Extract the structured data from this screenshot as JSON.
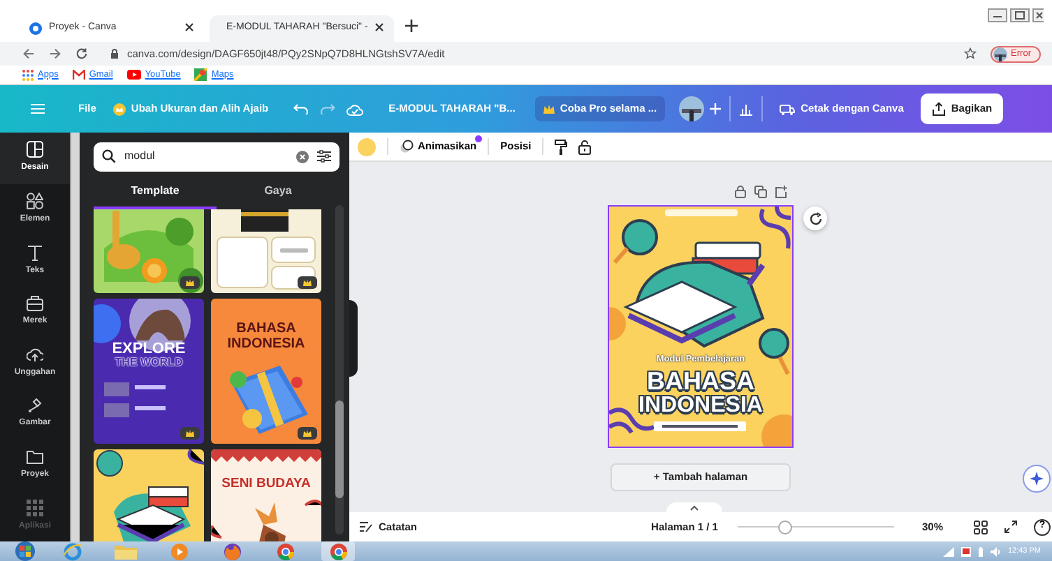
{
  "browser": {
    "tabs": [
      {
        "title": "Proyek - Canva",
        "selected": false
      },
      {
        "title": "E-MODUL TAHARAH \"Bersuci\" -",
        "selected": true
      }
    ],
    "address": "canva.com/design/DAGF650jt48/PQy2SNpQ7D8HLNGtshSV7A/edit",
    "profile_label": "Error",
    "bookmarks": [
      "Apps",
      "Gmail",
      "YouTube",
      "Maps"
    ]
  },
  "header": {
    "file_menu": "File",
    "magic_button": "Ubah Ukuran dan Alih Ajaib",
    "document_title": "E-MODUL TAHARAH \"B...",
    "pro_button": "Coba Pro selama ...",
    "print_button": "Cetak dengan Canva",
    "share_button": "Bagikan"
  },
  "rail": [
    {
      "label": "Desain",
      "selected": true
    },
    {
      "label": "Elemen",
      "selected": false
    },
    {
      "label": "Teks",
      "selected": false
    },
    {
      "label": "Merek",
      "selected": false
    },
    {
      "label": "Unggahan",
      "selected": false
    },
    {
      "label": "Gambar",
      "selected": false
    },
    {
      "label": "Proyek",
      "selected": false
    },
    {
      "label": "Aplikasi",
      "selected": false
    }
  ],
  "panel": {
    "search": {
      "value": "modul"
    },
    "tabs": [
      {
        "label": "Template",
        "selected": true
      },
      {
        "label": "Gaya",
        "selected": false
      }
    ],
    "templates": [
      {
        "kind": "nature",
        "premium": true
      },
      {
        "kind": "schedule",
        "premium": true
      },
      {
        "kind": "travel",
        "premium": true,
        "lines": [
          "EXPLORE",
          "THE WORLD"
        ]
      },
      {
        "kind": "language",
        "premium": true,
        "lines": [
          "BAHASA",
          "INDONESIA"
        ]
      },
      {
        "kind": "book"
      },
      {
        "kind": "culture",
        "lines": [
          "SENI BUDAYA"
        ]
      }
    ]
  },
  "toolbar": {
    "animate_button": "Animasikan",
    "animate_new": true,
    "position_button": "Posisi"
  },
  "canvas": {
    "page": {
      "selected": true,
      "subtitle": "Modul Pembelajaran",
      "title_lines": [
        "BAHASA",
        "INDONESIA"
      ]
    },
    "add_page_button": "+ Tambah halaman"
  },
  "footer": {
    "notes_button": "Catatan",
    "page_indicator": "Halaman 1 / 1",
    "zoom_slider": {
      "level": 0.3
    },
    "zoom_reading": "30%",
    "help_button": "?"
  },
  "taskbar": {
    "clock": "12:43 PM"
  }
}
